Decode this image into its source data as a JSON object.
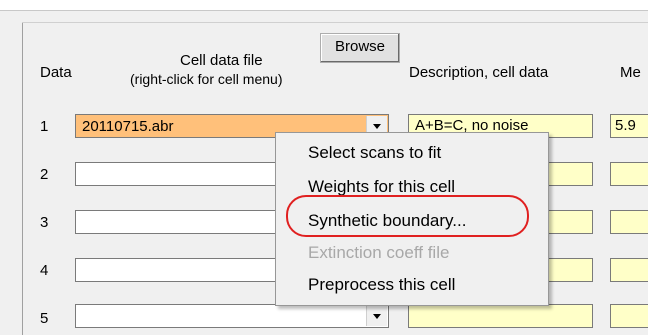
{
  "header": {
    "data_col": "Data",
    "cell_file_title": "Cell data file",
    "cell_file_subtitle": "(right-click for cell menu)",
    "browse_label": "Browse",
    "description_col": "Description, cell data",
    "mer_col": "Me"
  },
  "rows": [
    {
      "num": "1",
      "file": "20110715.abr",
      "description": "A+B=C, no noise",
      "mer": "5.9"
    },
    {
      "num": "2",
      "file": "",
      "description": "",
      "mer": ""
    },
    {
      "num": "3",
      "file": "",
      "description": "",
      "mer": ""
    },
    {
      "num": "4",
      "file": "",
      "description": "",
      "mer": ""
    },
    {
      "num": "5",
      "file": "",
      "description": "",
      "mer": ""
    }
  ],
  "context_menu": {
    "items": [
      {
        "label": "Select scans to fit",
        "enabled": true
      },
      {
        "label": "Weights for this cell",
        "enabled": true
      },
      {
        "label": "Synthetic boundary...",
        "enabled": true
      },
      {
        "label": "Extinction coeff file",
        "enabled": false
      },
      {
        "label": "Preprocess this cell",
        "enabled": true
      }
    ]
  },
  "colors": {
    "selected_cell": "#ffc07a",
    "input_yellow": "#ffffc8",
    "annotation_red": "#e02020"
  }
}
